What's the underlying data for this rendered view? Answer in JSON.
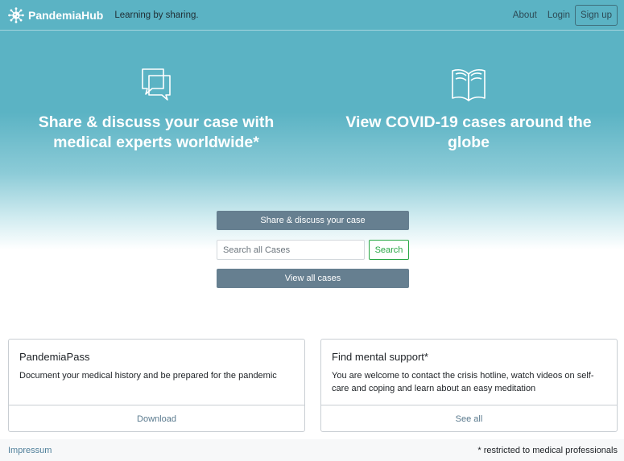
{
  "header": {
    "brand": "PandemiaHub",
    "tagline": "Learning by sharing.",
    "nav": {
      "about": "About",
      "login": "Login",
      "signup": "Sign up"
    }
  },
  "hero": {
    "left": {
      "icon": "chat-bubbles-icon",
      "title": "Share & discuss your case with medical experts worldwide*"
    },
    "right": {
      "icon": "open-book-icon",
      "title": "View COVID-19 cases around the globe"
    }
  },
  "actions": {
    "share_button": "Share & discuss your case",
    "search": {
      "placeholder": "Search all Cases",
      "value": "",
      "button": "Search"
    },
    "view_all_button": "View all cases"
  },
  "cards": [
    {
      "title": "PandemiaPass",
      "text": "Document your medical history and be prepared for the pandemic",
      "link": "Download"
    },
    {
      "title": "Find mental support*",
      "text": "You are welcome to contact the crisis hotline, watch videos on self-care and coping and learn about an easy meditation",
      "link": "See all"
    }
  ],
  "footer": {
    "impressum": "Impressum",
    "note": "* restricted to medical professionals"
  },
  "colors": {
    "hero": "#5bb3c4",
    "button": "#667f90",
    "search_green": "#28a745",
    "link": "#5a7a8e"
  }
}
